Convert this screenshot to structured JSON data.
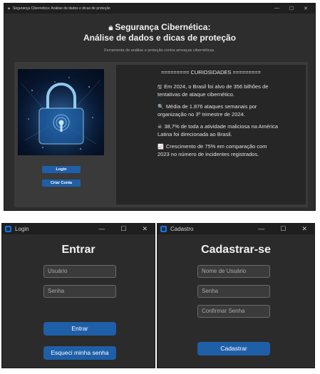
{
  "main_window": {
    "title": "Segurança Cibernética: Análise de dados e dicas de proteção",
    "header_line1": "Segurança Cibernética:",
    "header_line2": "Análise de dados e dicas de proteção",
    "subtitle": "Ferramenta de análise e proteção contra ameaças cibernéticas.",
    "login_button": "Login",
    "create_account_button": "Criar Conta",
    "curiosities_heading": "========= CURIOSIDADES =========",
    "facts": [
      {
        "icon": "floppy-icon",
        "glyph": "🖫",
        "text": "Em 2024, o Brasil foi alvo de 356 bilhões de tentativas de ataque cibernético."
      },
      {
        "icon": "magnifier-icon",
        "glyph": "🔍",
        "text": "Média de 1.876 ataques semanais por organização no 3º trimestre de 2024."
      },
      {
        "icon": "warning-icon",
        "glyph": "☠",
        "text": "38,7% de toda a atividade maliciosa na América Latina foi direcionada ao Brasil."
      },
      {
        "icon": "chart-icon",
        "glyph": "📈",
        "text": "Crescimento de 75% em comparação com 2023 no número de incidentes registrados."
      }
    ]
  },
  "login_window": {
    "title": "Login",
    "heading": "Entrar",
    "username_placeholder": "Usuário",
    "password_placeholder": "Senha",
    "enter_button": "Entrar",
    "forgot_button": "Esqueci minha senha"
  },
  "signup_window": {
    "title": "Cadastro",
    "heading": "Cadastrar-se",
    "username_placeholder": "Nome de Usuário",
    "password_placeholder": "Senha",
    "confirm_placeholder": "Confirmar Senha",
    "submit_button": "Cadastrar"
  },
  "colors": {
    "accent": "#1f5fa8",
    "window_bg": "#2d2d2d",
    "panel_bg": "#262626"
  }
}
